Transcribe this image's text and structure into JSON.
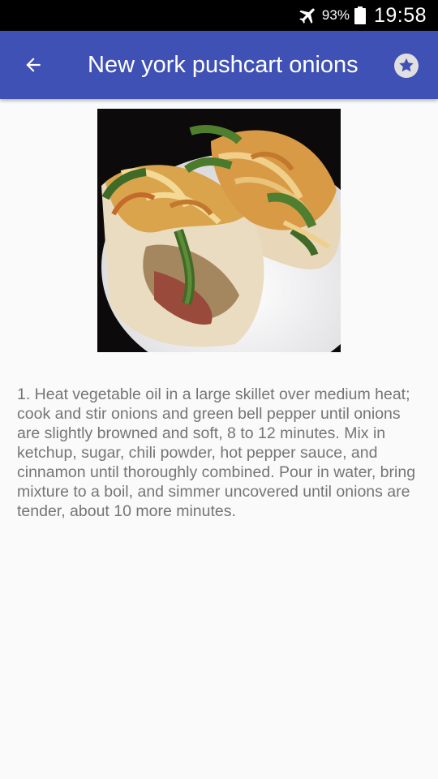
{
  "status_bar": {
    "battery_percent": "93%",
    "time": "19:58",
    "icons": [
      "airplane-mode-icon",
      "battery-icon"
    ]
  },
  "app_bar": {
    "title": "New york pushcart onions",
    "back_icon": "arrow-left-icon",
    "favorite_icon": "star-icon",
    "color": "#3f51b5"
  },
  "recipe": {
    "image_subject": "hot dogs topped with onions and green peppers",
    "directions": "1. Heat vegetable oil in a large skillet over medium heat; cook and stir onions and green bell pepper until onions are slightly browned and soft, 8 to 12 minutes. Mix in ketchup, sugar, chili powder, hot pepper sauce, and cinnamon until thoroughly combined. Pour in water, bring mixture to a boil, and simmer uncovered until onions are tender, about 10 more minutes."
  }
}
